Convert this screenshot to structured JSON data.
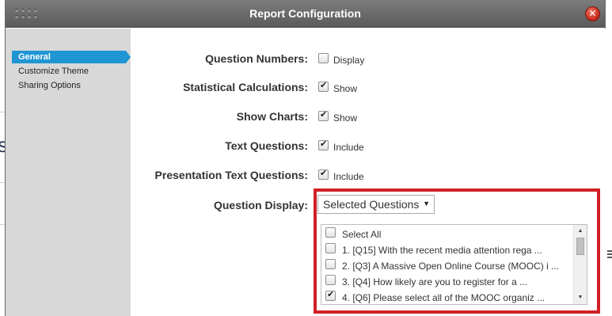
{
  "dialog": {
    "title": "Report Configuration",
    "close_label": "✕"
  },
  "sidebar": {
    "items": [
      {
        "label": "General",
        "active": true
      },
      {
        "label": "Customize Theme",
        "active": false
      },
      {
        "label": "Sharing Options",
        "active": false
      }
    ]
  },
  "settings": {
    "question_numbers": {
      "label": "Question Numbers:",
      "option": "Display",
      "checked": false
    },
    "statistical_calculations": {
      "label": "Statistical Calculations:",
      "option": "Show",
      "checked": true
    },
    "show_charts": {
      "label": "Show Charts:",
      "option": "Show",
      "checked": true
    },
    "text_questions": {
      "label": "Text Questions:",
      "option": "Include",
      "checked": true
    },
    "presentation_text_questions": {
      "label": "Presentation Text Questions:",
      "option": "Include",
      "checked": true
    },
    "question_display": {
      "label": "Question Display:",
      "selected": "Selected Questions"
    }
  },
  "question_list": {
    "items": [
      {
        "text": "Select All",
        "checked": false
      },
      {
        "text": "1. [Q15] With the recent media attention rega ...",
        "checked": false
      },
      {
        "text": "2. [Q3] A Massive Open Online Course (MOOC) i ...",
        "checked": false
      },
      {
        "text": "3. [Q4] How likely are you to register for a ...",
        "checked": false
      },
      {
        "text": "4. [Q6] Please select all of the MOOC organiz ...",
        "checked": true
      }
    ]
  },
  "colors": {
    "accent": "#1f96d3",
    "highlight": "#d21f26",
    "titlebar": "#6b6b6b"
  },
  "icons": {
    "close": "close-icon",
    "grip": "grip-icon",
    "dropdown": "chevron-down-icon"
  }
}
